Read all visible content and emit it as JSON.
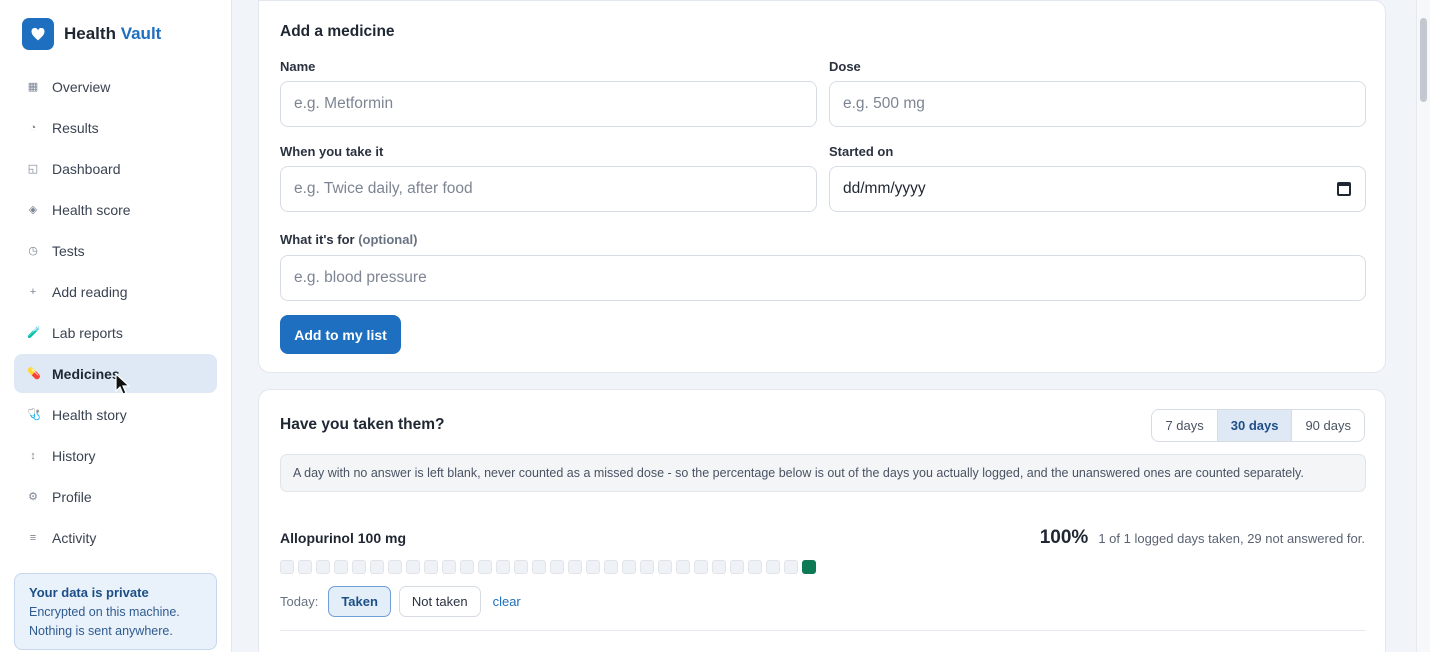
{
  "brand": {
    "name": "Health",
    "accent": "Vault",
    "icon": "heart-icon",
    "color": "#1e6fbf"
  },
  "sidebar": {
    "items": [
      {
        "label": "Overview",
        "icon": "grid-icon",
        "glyph": "▦"
      },
      {
        "label": "Results",
        "icon": "pie-icon",
        "glyph": "◔"
      },
      {
        "label": "Dashboard",
        "icon": "dashboard-icon",
        "glyph": "◱"
      },
      {
        "label": "Health score",
        "icon": "diamond-icon",
        "glyph": "◈"
      },
      {
        "label": "Tests",
        "icon": "clock-icon",
        "glyph": "◷"
      },
      {
        "label": "Add reading",
        "icon": "plus-icon",
        "glyph": "+"
      },
      {
        "label": "Lab reports",
        "icon": "test-tube-icon",
        "glyph": "🧪"
      },
      {
        "label": "Medicines",
        "icon": "pill-icon",
        "glyph": "💊",
        "active": true
      },
      {
        "label": "Health story",
        "icon": "stethoscope-icon",
        "glyph": "🩺"
      },
      {
        "label": "History",
        "icon": "arrows-vertical-icon",
        "glyph": "↕"
      },
      {
        "label": "Profile",
        "icon": "gear-icon",
        "glyph": "⚙"
      },
      {
        "label": "Activity",
        "icon": "list-icon",
        "glyph": "≡"
      }
    ],
    "privacy": {
      "title": "Your data is private",
      "line1": "Encrypted on this machine.",
      "line2": "Nothing is sent anywhere."
    }
  },
  "add_form": {
    "title": "Add a medicine",
    "name_label": "Name",
    "name_placeholder": "e.g. Metformin",
    "dose_label": "Dose",
    "dose_placeholder": "e.g. 500 mg",
    "when_label": "When you take it",
    "when_placeholder": "e.g. Twice daily, after food",
    "started_label": "Started on",
    "started_value": "dd/mm/yyyy",
    "purpose_label": "What it's for",
    "purpose_optional": "(optional)",
    "purpose_placeholder": "e.g. blood pressure",
    "submit_label": "Add to my list"
  },
  "adherence": {
    "title": "Have you taken them?",
    "ranges": [
      "7 days",
      "30 days",
      "90 days"
    ],
    "selected_range": "30 days",
    "note": "A day with no answer is left blank, never counted as a missed dose - so the percentage below is out of the days you actually logged, and the unanswered ones are counted separately.",
    "medicines": [
      {
        "name": "Allopurinol 100 mg",
        "percent": "100%",
        "summary": "1 of 1 logged days taken, 29 not answered for.",
        "days_total": 30,
        "days_taken_index": [
          29
        ],
        "today_label": "Today:",
        "taken_label": "Taken",
        "not_taken_label": "Not taken",
        "clear_label": "clear",
        "today_status": "Taken"
      }
    ],
    "taken_color": "#0d7a55"
  }
}
